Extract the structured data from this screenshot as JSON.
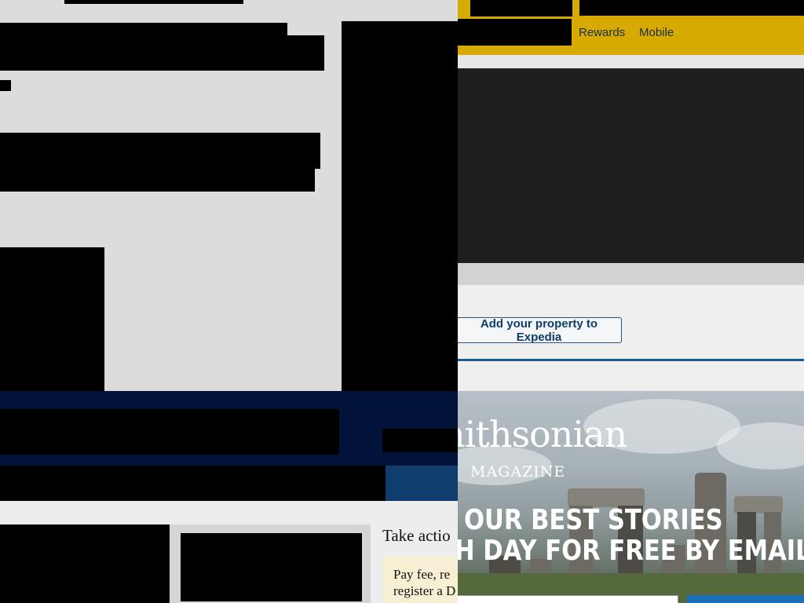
{
  "nav": {
    "items": [
      {
        "label": "Rewards"
      },
      {
        "label": "Mobile"
      }
    ],
    "color": "#d7aa02"
  },
  "expedia": {
    "add_property_label": "Add your property to Expedia",
    "accent": "#1b5d8f"
  },
  "government": {
    "take_action_heading": "Take actio",
    "pay_fee_text": "Pay fee, re\nregister a D"
  },
  "smithsonian": {
    "brand_name": "nithsonian",
    "brand_sub": "MAGAZINE",
    "headline_line1": "OUR BEST STORIES",
    "headline_line2": "H DAY FOR FREE BY EMAIL",
    "signup_color": "#1a6fb8"
  },
  "icons": [
    "video-player"
  ]
}
